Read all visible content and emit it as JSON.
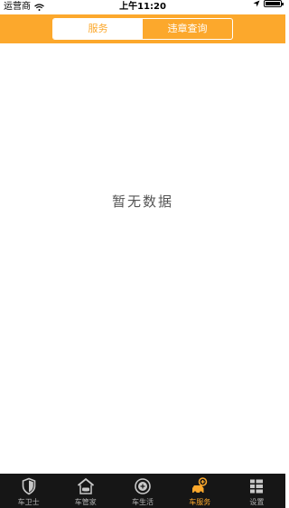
{
  "status_bar": {
    "carrier": "运营商",
    "time": "上午11:20"
  },
  "segment": {
    "tabs": [
      {
        "label": "服务",
        "selected": true
      },
      {
        "label": "违章查询",
        "selected": false
      }
    ]
  },
  "content": {
    "empty_text": "暂无数据"
  },
  "tab_bar": {
    "items": [
      {
        "label": "车卫士",
        "icon": "shield-icon",
        "active": false
      },
      {
        "label": "车管家",
        "icon": "garage-icon",
        "active": false
      },
      {
        "label": "车生活",
        "icon": "life-icon",
        "active": false
      },
      {
        "label": "车服务",
        "icon": "car-service-icon",
        "active": true
      },
      {
        "label": "设置",
        "icon": "settings-grid-icon",
        "active": false
      }
    ]
  },
  "colors": {
    "accent": "#fca82c",
    "tabbar_bg": "#161616",
    "inactive_tab": "#b3b3b3"
  }
}
